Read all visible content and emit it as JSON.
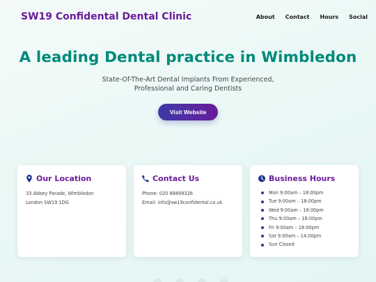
{
  "nav": {
    "brand": "SW19 Confidental Dental Clinic",
    "links": [
      "About",
      "Contact",
      "Hours",
      "Social"
    ]
  },
  "hero": {
    "title": "A leading Dental practice in Wimbledon",
    "subtitle": "State-Of-The-Art Dental Implants From Experienced, Professional and Caring Dentists",
    "cta_label": "Visit Website"
  },
  "location": {
    "title": "Our Location",
    "icon": "map-pin-icon",
    "line1": "33 Abbey Parade, Wimbledon",
    "line2": "London SW19 1DG"
  },
  "contact": {
    "title": "Contact Us",
    "icon": "phone-icon",
    "phone": "Phone: 020 88899326",
    "email": "Email: info@sw19confidental.co.uk"
  },
  "hours": {
    "title": "Business Hours",
    "icon": "clock-icon",
    "items": [
      "Mon 9:00am – 18:00pm",
      "Tue 9:00am – 18:00pm",
      "Wed 9:00am – 18:00pm",
      "Thu 9:00am – 18:00pm",
      "Fri 9:00am – 18:00pm",
      "Sat 9:00am – 14:00pm",
      "Sun Closed"
    ]
  },
  "colors": {
    "brand": "#6a1b9a",
    "accent": "#00897b",
    "icon": "#1e3a8a"
  }
}
